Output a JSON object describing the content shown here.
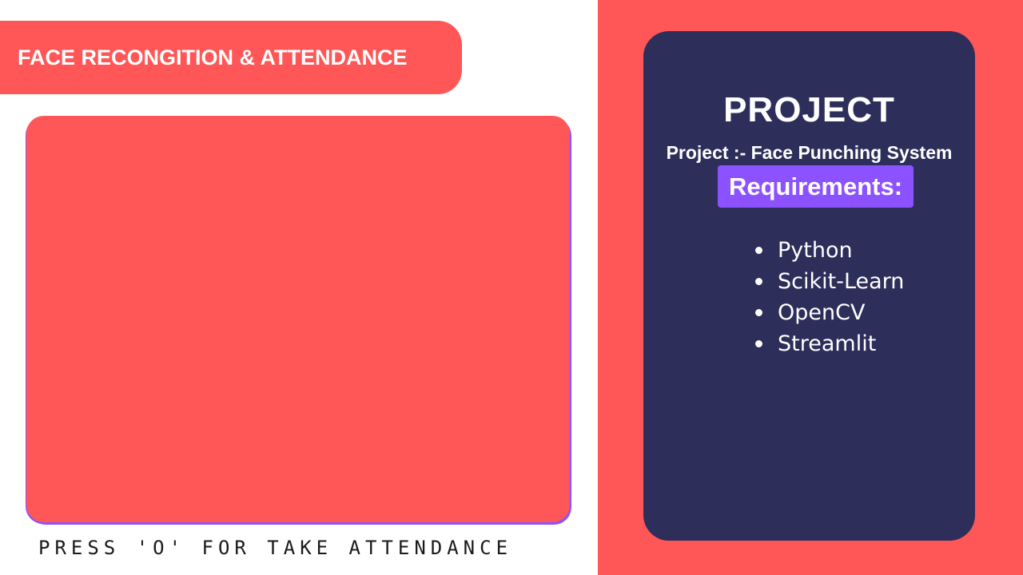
{
  "header": {
    "title": "FACE RECONGITION & ATTENDANCE"
  },
  "camera": {
    "instruction": "PRESS 'O' FOR TAKE ATTENDANCE"
  },
  "project_card": {
    "heading": "PROJECT",
    "subtitle": "Project :- Face Punching System",
    "requirements_label": "Requirements:",
    "requirements": [
      "Python",
      "Scikit-Learn",
      "OpenCV",
      "Streamlit"
    ]
  },
  "colors": {
    "accent_red": "#ff5757",
    "card_navy": "#2d2e5a",
    "badge_purple": "#8c52ff"
  }
}
